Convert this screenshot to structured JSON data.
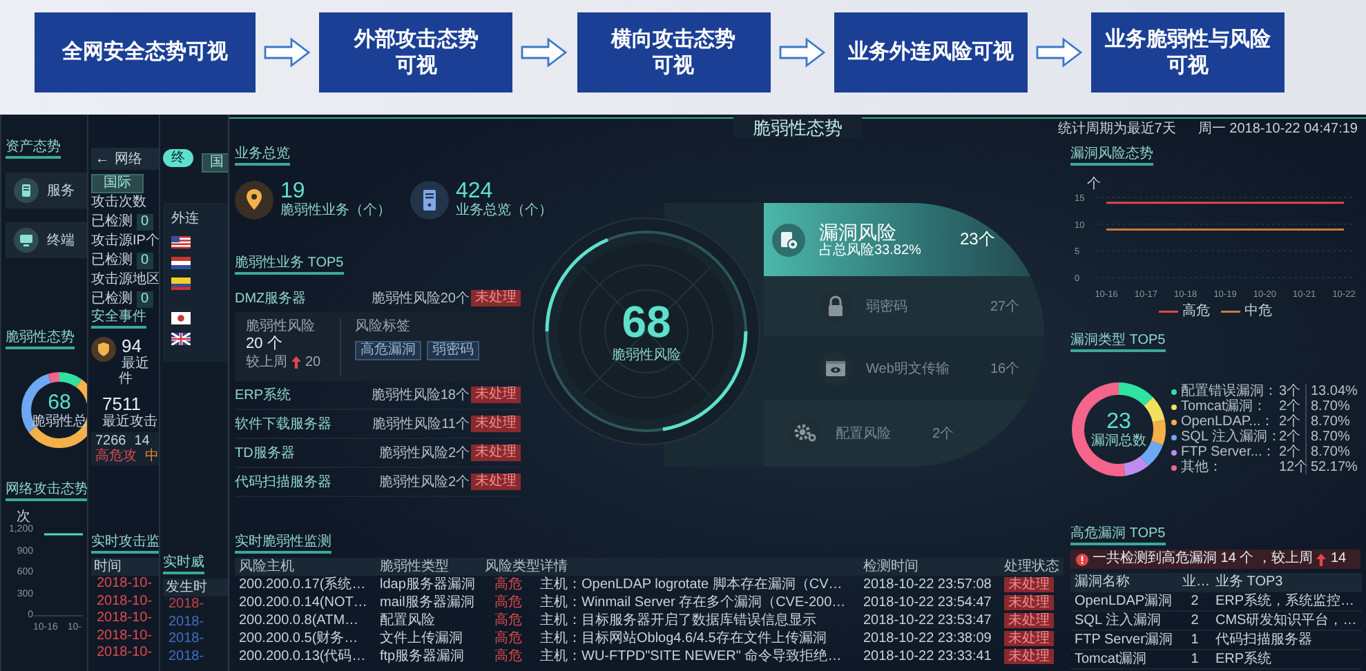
{
  "flow_steps": [
    {
      "lines": [
        "全网安全态势可视"
      ]
    },
    {
      "lines": [
        "外部攻击态势",
        "可视"
      ]
    },
    {
      "lines": [
        "横向攻击态势",
        "可视"
      ]
    },
    {
      "lines": [
        "业务外连风险可视"
      ]
    },
    {
      "lines": [
        "业务脆弱性与风险",
        "可视"
      ]
    }
  ],
  "asset_panel": {
    "title": "资产态势",
    "cards": [
      {
        "label": "服务",
        "kind": "server"
      },
      {
        "label": "终端",
        "kind": "terminal"
      }
    ],
    "vuln_title": "脆弱性态势",
    "donut_value": "68",
    "donut_label": "脆弱性总",
    "attack_title": "网络攻击态势",
    "unit": "次",
    "y_ticks": [
      "1,200",
      "900",
      "600",
      "300",
      "0"
    ],
    "x_ticks": [
      "10-16",
      "10-"
    ]
  },
  "attack_panel": {
    "back": "←",
    "title": "网络",
    "tab": "国际",
    "metrics": [
      {
        "label": "攻击次数",
        "status": "已检测",
        "value": "0"
      },
      {
        "label": "攻击源IP个",
        "status": "已检测",
        "value": "0"
      },
      {
        "label": "攻击源地区",
        "status": "已检测",
        "value": "0"
      }
    ],
    "events_title": "安全事件",
    "events_count": "94",
    "events_label": "最近",
    "events_unit": "件",
    "attack_total": "7511",
    "attack_label": "最近攻击",
    "high": "7266",
    "medium": "14",
    "high_label": "高危攻",
    "medium_label": "中",
    "monitor_title": "实时攻击监",
    "time_header": "时间",
    "times": [
      "2018-10-",
      "2018-10-",
      "2018-10-",
      "2018-10-",
      "2018-10-"
    ]
  },
  "outbound_panel": {
    "toggle": "终",
    "tab": "国",
    "title": "外连",
    "monitor_title": "实时威",
    "time_header": "发生时",
    "times": [
      {
        "text": "2018-",
        "color": "#c8414a"
      },
      {
        "text": "2018-",
        "color": "#3f6fc4"
      },
      {
        "text": "2018-",
        "color": "#3f6fc4"
      },
      {
        "text": "2018-",
        "color": "#3f6fc4"
      }
    ]
  },
  "header": {
    "title": "脆弱性态势",
    "period": "统计周期为最近7天",
    "datetime": "周一 2018-10-22 04:47:19"
  },
  "overview": {
    "title": "业务总览",
    "stats": [
      {
        "value": "19",
        "label": "脆弱性业务（个）",
        "kind": "pin"
      },
      {
        "value": "424",
        "label": "业务总览（个）",
        "kind": "server"
      }
    ]
  },
  "top5": {
    "title": "脆弱性业务 TOP5",
    "items": [
      {
        "name": "DMZ服务器",
        "risk": "脆弱性风险20个",
        "status": "未处理",
        "expanded": true,
        "detail": {
          "label": "脆弱性风险",
          "count": "20 个",
          "compare": "较上周",
          "change": "20",
          "tags_title": "风险标签",
          "tags": [
            "高危漏洞",
            "弱密码"
          ]
        }
      },
      {
        "name": "ERP系统",
        "risk": "脆弱性风险18个",
        "status": "未处理",
        "expanded": false
      },
      {
        "name": "软件下载服务器",
        "risk": "脆弱性风险11个",
        "status": "未处理",
        "expanded": false
      },
      {
        "name": "TD服务器",
        "risk": "脆弱性风险2个",
        "status": "未处理",
        "expanded": false
      },
      {
        "name": "代码扫描服务器",
        "risk": "脆弱性风险2个",
        "status": "未处理",
        "expanded": false
      }
    ]
  },
  "gauge": {
    "value": "68",
    "label": "脆弱性风险"
  },
  "risk_types": [
    {
      "name": "漏洞风险",
      "count": "23个",
      "share": "占总风险33.82%",
      "selected": true,
      "kind": "vuln"
    },
    {
      "name": "弱密码",
      "count": "27个",
      "selected": false,
      "kind": "lock"
    },
    {
      "name": "Web明文传输",
      "count": "16个",
      "selected": false,
      "kind": "browser"
    },
    {
      "name": "配置风险",
      "count": "2个",
      "selected": false,
      "kind": "gears"
    }
  ],
  "monitor": {
    "title": "实时脆弱性监测",
    "columns": [
      "风险主机",
      "脆弱性类型",
      "风险类型",
      "详情",
      "检测时间",
      "处理状态"
    ],
    "rows": [
      {
        "host": "200.200.0.17(系统…",
        "type": "ldap服务器漏洞",
        "risk": "高危",
        "detail": "主机：OpenLDAP logrotate 脚本存在漏洞（CV…",
        "time": "2018-10-22 23:57:08",
        "status": "未处理"
      },
      {
        "host": "200.200.0.14(NOT…",
        "type": "mail服务器漏洞",
        "risk": "高危",
        "detail": "主机：Winmail Server 存在多个漏洞（CVE-200…",
        "time": "2018-10-22 23:54:47",
        "status": "未处理"
      },
      {
        "host": "200.200.0.8(ATM…",
        "type": "配置风险",
        "risk": "高危",
        "detail": "主机：目标服务器开启了数据库错误信息显示",
        "time": "2018-10-22 23:53:47",
        "status": "未处理"
      },
      {
        "host": "200.200.0.5(财务…",
        "type": "文件上传漏洞",
        "risk": "高危",
        "detail": "主机：目标网站Oblog4.6/4.5存在文件上传漏洞",
        "time": "2018-10-22 23:38:09",
        "status": "未处理"
      },
      {
        "host": "200.200.0.13(代码…",
        "type": "ftp服务器漏洞",
        "risk": "高危",
        "detail": "主机：WU-FTPD\"SITE NEWER\" 命令导致拒绝…",
        "time": "2018-10-22 23:33:41",
        "status": "未处理"
      }
    ]
  },
  "trend": {
    "title": "漏洞风险态势",
    "chart_data": {
      "type": "line",
      "ylabel": "个",
      "categories": [
        "10-16",
        "10-17",
        "10-18",
        "10-19",
        "10-20",
        "10-21",
        "10-22"
      ],
      "series": [
        {
          "name": "高危",
          "color": "#e0474b",
          "values": [
            14,
            14,
            14,
            14,
            14,
            14,
            14
          ]
        },
        {
          "name": "中危",
          "color": "#c97b3e",
          "values": [
            9,
            9,
            9,
            9,
            9,
            9,
            9
          ]
        }
      ],
      "ylim": [
        0,
        15
      ],
      "yticks": [
        0,
        5,
        10,
        15
      ]
    }
  },
  "vuln_types": {
    "title": "漏洞类型 TOP5",
    "total": "23",
    "total_label": "漏洞总数",
    "chart_data": {
      "type": "donut",
      "categories": [
        "配置错误漏洞",
        "Tomcat漏洞",
        "OpenLDAP...",
        "SQL 注入漏洞",
        "FTP Server...",
        "其他"
      ],
      "values": [
        13.04,
        8.7,
        8.7,
        8.7,
        8.7,
        52.17
      ]
    },
    "legend": [
      {
        "separator": "：",
        "count": "3个",
        "percent": "13.04%",
        "color": "#2fe3a3"
      },
      {
        "separator": "：",
        "count": "2个",
        "percent": "8.70%",
        "color": "#f3df5e"
      },
      {
        "separator": "：",
        "count": "2个",
        "percent": "8.70%",
        "color": "#f5b04a"
      },
      {
        "separator": "：",
        "count": "2个",
        "percent": "8.70%",
        "color": "#6ea8f2"
      },
      {
        "separator": "：",
        "count": "2个",
        "percent": "8.70%",
        "color": "#c08cf2"
      },
      {
        "separator": "：",
        "count": "12个",
        "percent": "52.17%",
        "color": "#f5648b"
      }
    ]
  },
  "high_risk": {
    "title": "高危漏洞 TOP5",
    "alert": "一共检测到高危漏洞 14 个 ，较上周",
    "change": "14",
    "columns": [
      "漏洞名称",
      "业…",
      "业务 TOP3"
    ],
    "rows": [
      [
        "OpenLDAP漏洞",
        "2",
        "ERP系统，系统监控…"
      ],
      [
        "SQL 注入漏洞",
        "2",
        "CMS研发知识平台，…"
      ],
      [
        "FTP Server漏洞",
        "1",
        "代码扫描服务器"
      ],
      [
        "Tomcat漏洞",
        "1",
        "ERP系统"
      ]
    ]
  }
}
